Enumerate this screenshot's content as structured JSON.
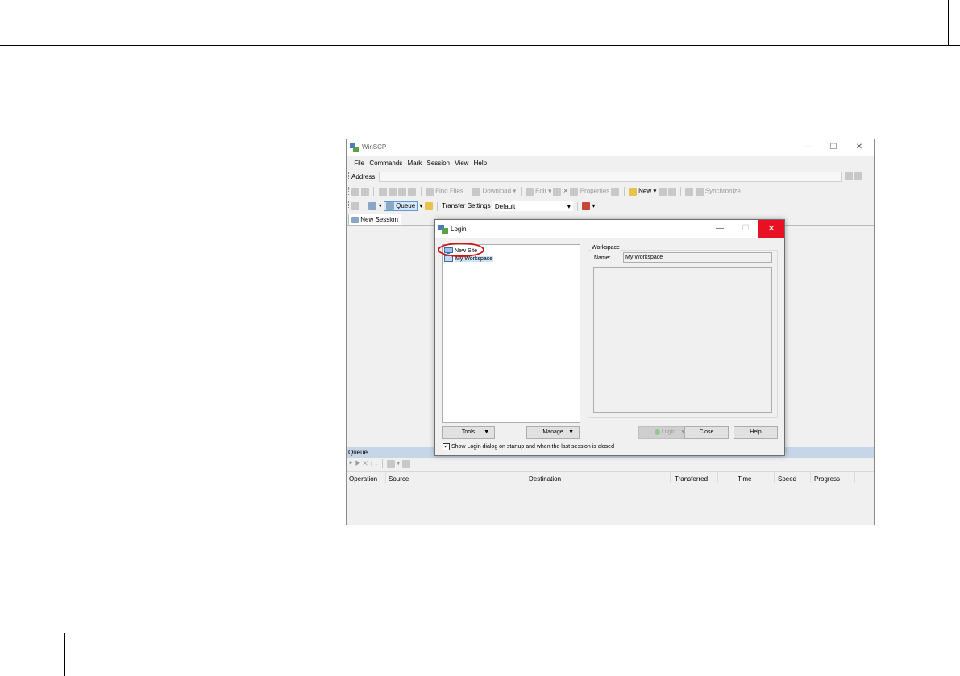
{
  "app": {
    "title": "WinSCP",
    "window_controls": {
      "minimize": "—",
      "maximize": "☐",
      "close": "✕"
    }
  },
  "menu": [
    "File",
    "Commands",
    "Mark",
    "Session",
    "View",
    "Help"
  ],
  "address": {
    "label": "Address"
  },
  "toolbar": {
    "find_files": "Find Files",
    "download": "Download",
    "edit": "Edit",
    "properties": "Properties",
    "new": "New",
    "synchronize": "Synchronize",
    "queue": "Queue",
    "transfer_settings_label": "Transfer Settings",
    "transfer_settings_value": "Default"
  },
  "session_tab": {
    "label": "New Session"
  },
  "queue_panel": {
    "title": "Queue",
    "columns": [
      "Operation",
      "Source",
      "Destination",
      "Transferred",
      "Time",
      "Speed",
      "Progress"
    ]
  },
  "login_dialog": {
    "title": "Login",
    "sites": [
      {
        "label": "New Site"
      },
      {
        "label": "My Workspace"
      }
    ],
    "workspace": {
      "group_label": "Workspace",
      "name_label": "Name:",
      "name_value": "My Workspace"
    },
    "buttons": {
      "tools": "Tools",
      "manage": "Manage",
      "login": "Login",
      "close": "Close",
      "help": "Help"
    },
    "startup_checkbox": {
      "label": "Show Login dialog on startup and when the last session is closed",
      "checked": true
    }
  },
  "colors": {
    "highlight_circle": "#d01818",
    "dialog_close": "#e81123",
    "queue_header": "#c6d6e8",
    "selection": "#cce4f7"
  }
}
